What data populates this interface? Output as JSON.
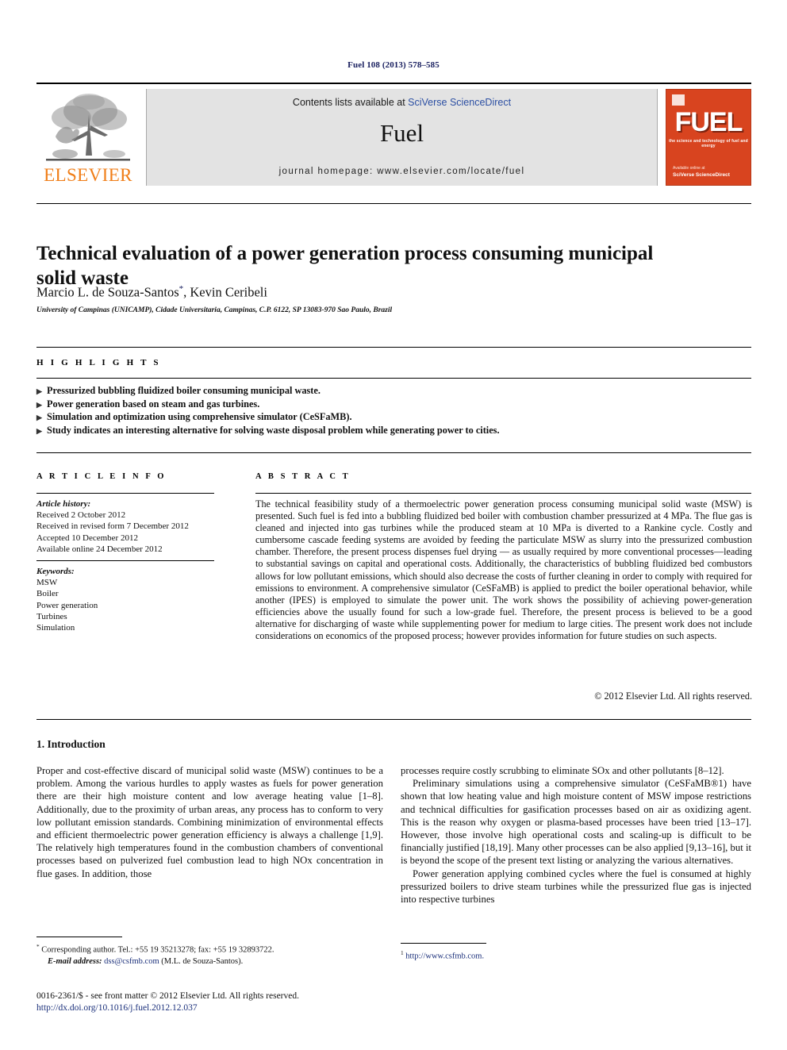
{
  "running_head": "Fuel 108 (2013) 578–585",
  "masthead": {
    "publisher_logo_name": "elsevier-tree-logo",
    "publisher_word": "ELSEVIER",
    "contents_prefix": "Contents lists available at ",
    "contents_link": "SciVerse ScienceDirect",
    "journal_name": "Fuel",
    "homepage": "journal homepage: www.elsevier.com/locate/fuel",
    "cover": {
      "title": "FUEL",
      "subtitle": "the science and technology of fuel and energy",
      "footer_line1": "Available online at",
      "footer_line2": "SciVerse ScienceDirect"
    }
  },
  "article": {
    "title": "Technical evaluation of a power generation process consuming municipal solid waste",
    "authors": "Marcio L. de Souza-Santos",
    "author_marker": "*",
    "authors_tail": ", Kevin Ceribeli",
    "affiliation": "University of Campinas (UNICAMP), Cidade Universitaria, Campinas, C.P. 6122, SP 13083-970 Sao Paulo, Brazil"
  },
  "highlights": {
    "heading": "H I G H L I G H T S",
    "bullet_glyph": "▶",
    "items": [
      "Pressurized bubbling fluidized boiler consuming municipal waste.",
      "Power generation based on steam and gas turbines.",
      "Simulation and optimization using comprehensive simulator (CeSFaMB).",
      "Study indicates an interesting alternative for solving waste disposal problem while generating power to cities."
    ]
  },
  "article_info": {
    "heading": "A R T I C L E   I N F O",
    "history_label": "Article history:",
    "history": [
      "Received 2 October 2012",
      "Received in revised form 7 December 2012",
      "Accepted 10 December 2012",
      "Available online 24 December 2012"
    ],
    "keywords_label": "Keywords:",
    "keywords": [
      "MSW",
      "Boiler",
      "Power generation",
      "Turbines",
      "Simulation"
    ]
  },
  "abstract": {
    "heading": "A B S T R A C T",
    "text": "The technical feasibility study of a thermoelectric power generation process consuming municipal solid waste (MSW) is presented. Such fuel is fed into a bubbling fluidized bed boiler with combustion chamber pressurized at 4 MPa. The flue gas is cleaned and injected into gas turbines while the produced steam at 10 MPa is diverted to a Rankine cycle. Costly and cumbersome cascade feeding systems are avoided by feeding the particulate MSW as slurry into the pressurized combustion chamber. Therefore, the present process dispenses fuel drying — as usually required by more conventional processes—leading to substantial savings on capital and operational costs. Additionally, the characteristics of bubbling fluidized bed combustors allows for low pollutant emissions, which should also decrease the costs of further cleaning in order to comply with required for emissions to environment. A comprehensive simulator (CeSFaMB) is applied to predict the boiler operational behavior, while another (IPES) is employed to simulate the power unit. The work shows the possibility of achieving power-generation efficiencies above the usually found for such a low-grade fuel. Therefore, the present process is believed to be a good alternative for discharging of waste while supplementing power for medium to large cities. The present work does not include considerations on economics of the proposed process; however provides information for future studies on such aspects.",
    "copyright": "© 2012 Elsevier Ltd. All rights reserved."
  },
  "section": {
    "heading": "1. Introduction",
    "left_paragraphs": [
      "Proper and cost-effective discard of municipal solid waste (MSW) continues to be a problem. Among the various hurdles to apply wastes as fuels for power generation there are their high moisture content and low average heating value [1–8]. Additionally, due to the proximity of urban areas, any process has to conform to very low pollutant emission standards. Combining minimization of environmental effects and efficient thermoelectric power generation efficiency is always a challenge [1,9]. The relatively high temperatures found in the combustion chambers of conventional processes based on pulverized fuel combustion lead to high NOx concentration in flue gases. In addition, those"
    ],
    "right_paragraphs": [
      "processes require costly scrubbing to eliminate SOx and other pollutants [8–12].",
      "Preliminary simulations using a comprehensive simulator (CeSFaMB®1) have shown that low heating value and high moisture content of MSW impose restrictions and technical difficulties for gasification processes based on air as oxidizing agent. This is the reason why oxygen or plasma-based processes have been tried [13–17]. However, those involve high operational costs and scaling-up is difficult to be financially justified [18,19]. Many other processes can be also applied [9,13–16], but it is beyond the scope of the present text listing or analyzing the various alternatives.",
      "Power generation applying combined cycles where the fuel is consumed at highly pressurized boilers to drive steam turbines while the pressurized flue gas is injected into respective turbines"
    ]
  },
  "footnotes": {
    "corresponding_marker": "*",
    "corresponding": "Corresponding author. Tel.: +55 19 35213278; fax: +55 19 32893722.",
    "email_label": "E-mail address:",
    "email": "dss@csfmb.com",
    "email_suffix": "(M.L. de Souza-Santos).",
    "right_marker": "1",
    "right_note": "http://www.csfmb.com."
  },
  "imprint": {
    "line1": "0016-2361/$ - see front matter © 2012 Elsevier Ltd. All rights reserved.",
    "doi": "http://dx.doi.org/10.1016/j.fuel.2012.12.037"
  },
  "colors": {
    "link_blue": "#1a2f7a",
    "sciencedirect_blue": "#2c4fa3",
    "elsevier_orange": "#F07E18",
    "cover_red": "#D8441F"
  }
}
